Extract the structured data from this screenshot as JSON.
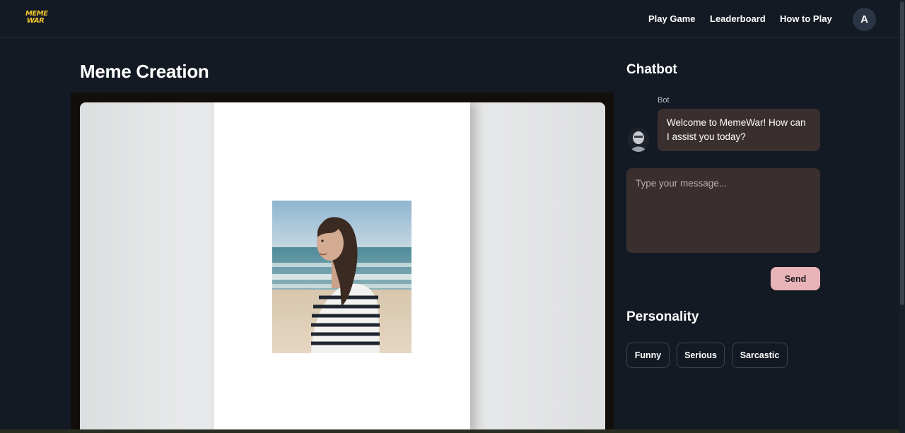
{
  "header": {
    "logo": {
      "line1": "MEME",
      "line2": "WAR"
    },
    "nav": [
      {
        "label": "Play Game"
      },
      {
        "label": "Leaderboard"
      },
      {
        "label": "How to Play"
      }
    ],
    "avatar_initial": "A"
  },
  "main": {
    "title": "Meme Creation"
  },
  "chatbot": {
    "title": "Chatbot",
    "bot_label": "Bot",
    "bot_message": "Welcome to MemeWar! How can I assist you today?",
    "input_placeholder": "Type your message...",
    "input_value": "",
    "send_label": "Send"
  },
  "personality": {
    "title": "Personality",
    "options": [
      {
        "label": "Funny"
      },
      {
        "label": "Serious"
      },
      {
        "label": "Sarcastic"
      }
    ]
  },
  "colors": {
    "background": "#141a23",
    "logo": "#f3c730",
    "bubble": "#3a2f2f",
    "send_button": "#e9b4b8"
  }
}
